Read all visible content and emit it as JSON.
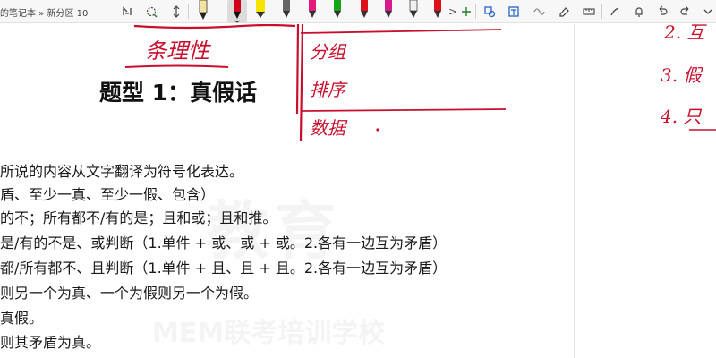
{
  "toolbar": {
    "breadcrumb": "的笔记本 » 新分区 10",
    "more_label": ">",
    "pens": [
      {
        "name": "pen-black",
        "color": "#222222"
      },
      {
        "name": "pen-red-selected",
        "color": "#d0021b"
      },
      {
        "name": "highlighter-yellow",
        "color": "#f5e400"
      },
      {
        "name": "pen-gray",
        "color": "#555555"
      },
      {
        "name": "pen-pink",
        "color": "#e8177d"
      },
      {
        "name": "pen-green",
        "color": "#19a319"
      },
      {
        "name": "pen-red-2",
        "color": "#e0101a"
      },
      {
        "name": "pen-magenta",
        "color": "#d81b8a"
      },
      {
        "name": "pen-dark",
        "color": "#333333"
      }
    ]
  },
  "page": {
    "title": "题型 1：真假话",
    "lines": [
      "所说的内容从文字翻译为符号化表达。",
      "盾、至少一真、至少一假、包含）",
      "的不；所有都不/有的是；且和或；且和推。",
      "是/有的不是、或判断（1.单件 + 或、或 + 或。2.各有一边互为矛盾）",
      "都/所有都不、且判断（1.单件 + 且、且 + 且。2.各有一边互为矛盾）",
      "则另一个为真、一个为假则另一个为假。",
      "真假。",
      "则其矛盾为真。"
    ],
    "watermark_main": "教育",
    "watermark_sub": "MEM联考培训学校"
  },
  "ink": {
    "color": "#c8102e",
    "left_note": "条理性",
    "mid_items": [
      "分组",
      "排序",
      "数据"
    ],
    "right_items": [
      "2. 互",
      "3. 假",
      "4. 只"
    ]
  }
}
